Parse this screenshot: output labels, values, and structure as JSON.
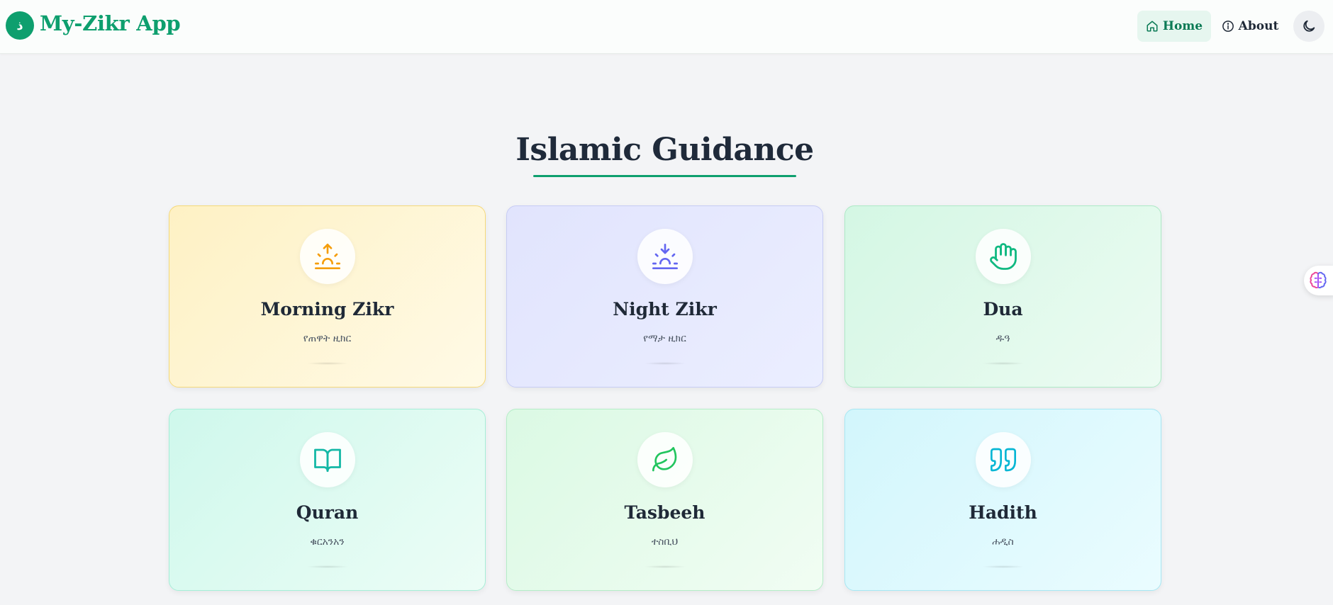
{
  "header": {
    "logo_glyph": "ذ",
    "app_title": "My-Zikr App",
    "nav": {
      "home_label": "Home",
      "about_label": "About"
    },
    "theme_toggle_icon": "moon-icon"
  },
  "main": {
    "title": "Islamic Guidance",
    "cards": [
      {
        "title": "Morning Zikr",
        "subtitle": "የጠዋት ዚክር",
        "icon": "sunrise-icon",
        "color": "#f59e0b"
      },
      {
        "title": "Night Zikr",
        "subtitle": "የማታ ዚክር",
        "icon": "sunset-icon",
        "color": "#6366f1"
      },
      {
        "title": "Dua",
        "subtitle": "ዱዓ",
        "icon": "hand-icon",
        "color": "#10b981"
      },
      {
        "title": "Quran",
        "subtitle": "ቁርአንአን",
        "icon": "book-open-icon",
        "color": "#14b8a6"
      },
      {
        "title": "Tasbeeh",
        "subtitle": "ተስቢህ",
        "icon": "leaf-icon",
        "color": "#22c55e"
      },
      {
        "title": "Hadith",
        "subtitle": "ሐዲስ",
        "icon": "quote-icon",
        "color": "#06b6d4"
      }
    ]
  },
  "floating": {
    "icon": "brain-icon"
  },
  "colors": {
    "brand": "#0e9f6e",
    "background": "#f3f4f6"
  }
}
